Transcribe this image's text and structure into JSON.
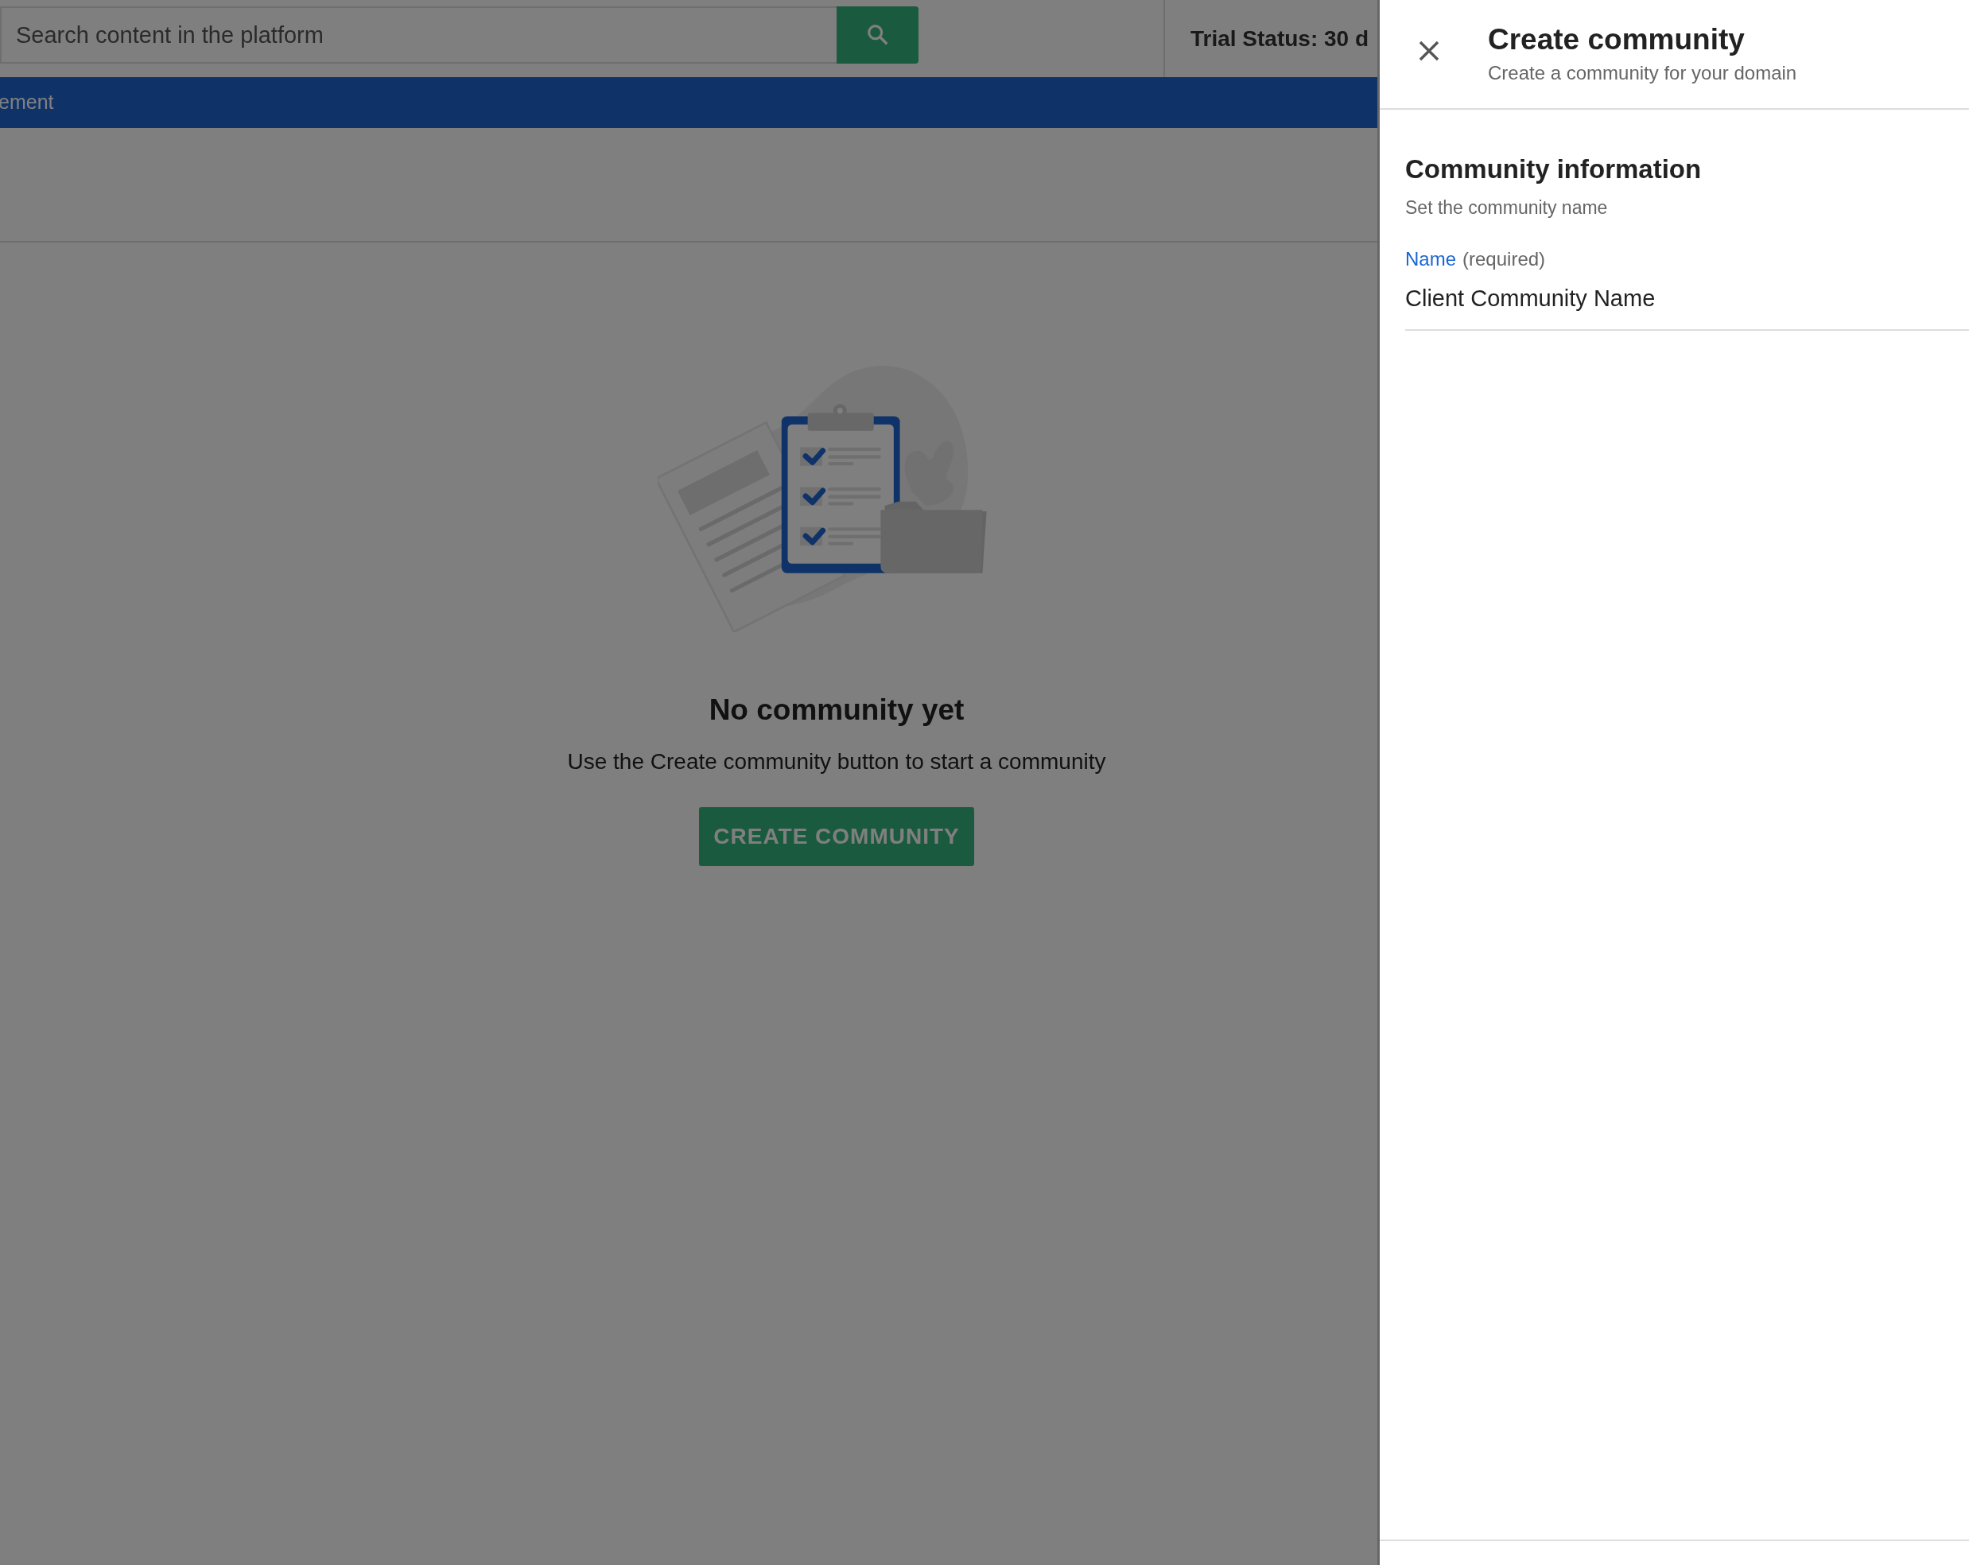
{
  "search": {
    "placeholder": "Search content in the platform"
  },
  "trial_status": "Trial Status: 30 d",
  "nav": {
    "label": "ement"
  },
  "empty_state": {
    "title": "No community yet",
    "text": "Use the Create community button to start a community",
    "button": "CREATE COMMUNITY"
  },
  "drawer": {
    "title": "Create community",
    "subtitle": "Create a community for your domain",
    "section": {
      "title": "Community information",
      "subtitle": "Set the community name"
    },
    "field": {
      "label": "Name",
      "note": "(required)",
      "value": "Client Community Name"
    }
  }
}
